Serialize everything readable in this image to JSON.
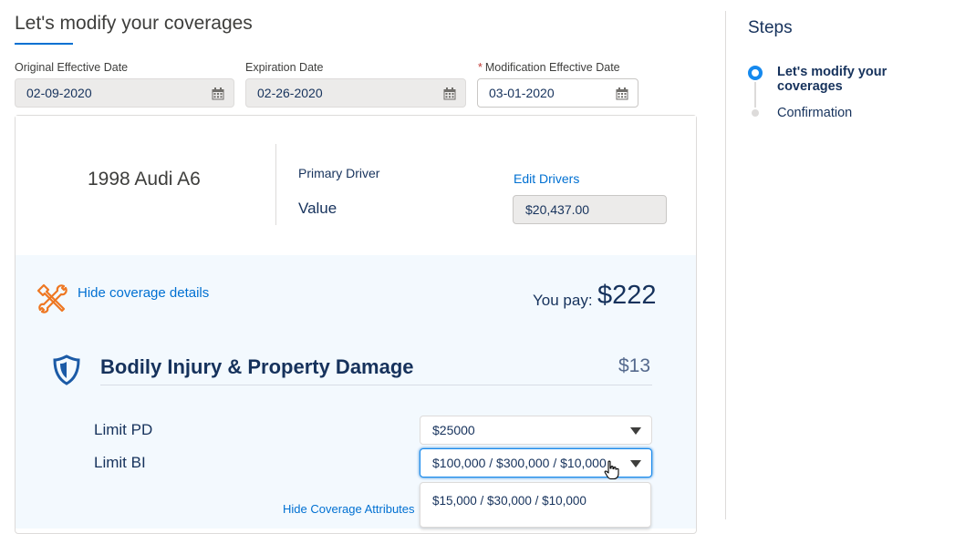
{
  "header": {
    "title": "Let's modify your coverages"
  },
  "dates": {
    "original": {
      "label": "Original Effective Date",
      "value": "02-09-2020"
    },
    "expiration": {
      "label": "Expiration Date",
      "value": "02-26-2020"
    },
    "modification": {
      "required_mark": "*",
      "label": "Modification Effective Date",
      "value": "03-01-2020"
    }
  },
  "vehicle": {
    "name": "1998 Audi A6",
    "primary_driver_label": "Primary Driver",
    "edit_drivers_label": "Edit Drivers",
    "value_label": "Value",
    "value": "$20,437.00"
  },
  "coverage": {
    "hide_details_label": "Hide coverage details",
    "you_pay_label": "You pay:",
    "you_pay_amount": "$222",
    "section_title": "Bodily Injury & Property Damage",
    "section_price": "$13",
    "limit_pd": {
      "label": "Limit PD",
      "value": "$25000"
    },
    "limit_bi": {
      "label": "Limit BI",
      "value": "$100,000 / $300,000 / $10,000"
    },
    "dropdown_options": [
      "$15,000 / $30,000 / $10,000"
    ],
    "hide_attributes_label": "Hide Coverage Attributes"
  },
  "steps": {
    "title": "Steps",
    "items": [
      {
        "label": "Let's modify your coverages",
        "state": "active"
      },
      {
        "label": "Confirmation",
        "state": "pending"
      }
    ]
  },
  "icons": {
    "calendar": "calendar-icon",
    "tools": "tools-icon",
    "shield": "shield-icon",
    "chevron": "chevron-down-icon",
    "cursor": "hand-cursor-icon"
  },
  "colors": {
    "accent": "#0070d2",
    "text": "#16325c",
    "tool_orange": "#ee7722"
  }
}
